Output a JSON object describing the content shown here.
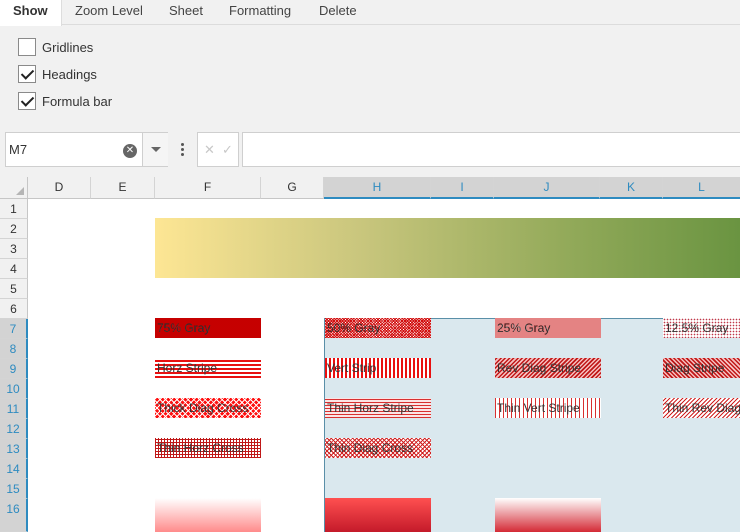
{
  "ribbon": {
    "tabs": [
      "Show",
      "Zoom Level",
      "Sheet",
      "Formatting",
      "Delete"
    ],
    "active_tab": "Show",
    "options": [
      {
        "label": "Gridlines",
        "checked": false
      },
      {
        "label": "Headings",
        "checked": true
      },
      {
        "label": "Formula bar",
        "checked": true
      }
    ]
  },
  "formula_bar": {
    "name_box": "M7",
    "clear_glyph": "✕",
    "cancel_glyph": "✕",
    "confirm_glyph": "✓",
    "formula": ""
  },
  "grid": {
    "columns": [
      "D",
      "E",
      "F",
      "G",
      "H",
      "I",
      "J",
      "K",
      "L"
    ],
    "selected_columns": [
      "H",
      "I",
      "J",
      "K",
      "L"
    ],
    "rows": [
      "1",
      "2",
      "3",
      "4",
      "5",
      "6",
      "7",
      "8",
      "9",
      "10",
      "11",
      "12",
      "13",
      "14",
      "15",
      "16"
    ],
    "selected_rows": [
      "7",
      "8",
      "9",
      "10",
      "11",
      "12",
      "13",
      "14",
      "15",
      "16"
    ]
  },
  "cells": {
    "f7": "75% Gray",
    "h7": "50% Gray",
    "j7": "25% Gray",
    "l7": "12.5% Gray",
    "f9": "Horz Stripe",
    "h9": "Vert Strip",
    "j9": "Rev Diag Stripe",
    "l9": "Diag Stripe",
    "f11": "Thick Diag Cross",
    "h11": "Thin Horz Stripe",
    "j11": "Thin Vert Stripe",
    "l11": "Thin Rev Diag Stripe",
    "f13": "Thin Horz Cross",
    "h13": "Thin Diag Cross"
  },
  "colors": {
    "selection_fill": "#dae8ee",
    "selection_accent": "#2e8bc0",
    "pattern_red": "#ff0000",
    "gradient_start": "#fde694",
    "gradient_end": "#6a9441"
  }
}
